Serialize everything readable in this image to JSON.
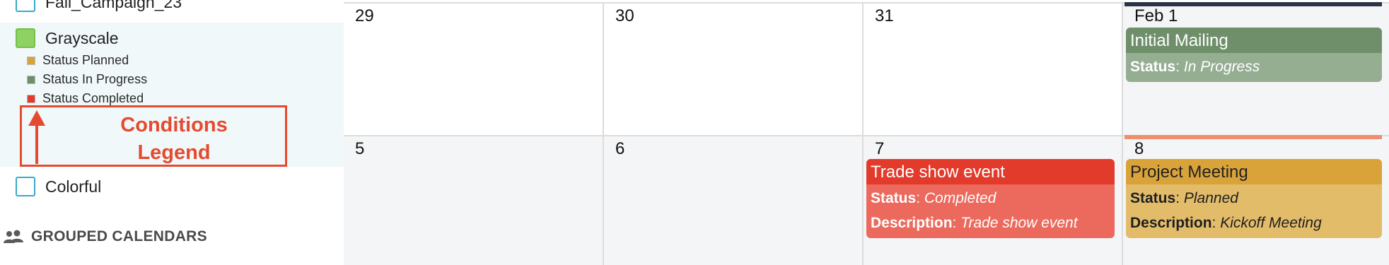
{
  "sidebar": {
    "calendars": [
      {
        "label": "Fall_Campaign_23"
      },
      {
        "label": "Grayscale",
        "color": "#8fd162"
      },
      {
        "label": "Colorful"
      }
    ],
    "legend": [
      {
        "label": "Status Planned",
        "color": "#d9a33a"
      },
      {
        "label": "Status In Progress",
        "color": "#6e8f6a"
      },
      {
        "label": "Status Completed",
        "color": "#e23a2b"
      }
    ],
    "annotation": {
      "line1": "Conditions",
      "line2": "Legend",
      "color": "#e64a2e"
    },
    "grouped_title": "GROUPED CALENDARS"
  },
  "calendar": {
    "week1": [
      "29",
      "30",
      "31",
      "Feb 1"
    ],
    "week2": [
      "5",
      "6",
      "7",
      "8"
    ],
    "events": {
      "initial_mailing": {
        "title": "Initial Mailing",
        "status_key": "Status",
        "status": "In Progress"
      },
      "trade_show": {
        "title": "Trade show event",
        "status_key": "Status",
        "status": "Completed",
        "desc_key": "Description",
        "desc": "Trade show event"
      },
      "project_meeting": {
        "title": "Project Meeting",
        "status_key": "Status",
        "status": "Planned",
        "desc_key": "Description",
        "desc": "Kickoff Meeting"
      }
    }
  }
}
